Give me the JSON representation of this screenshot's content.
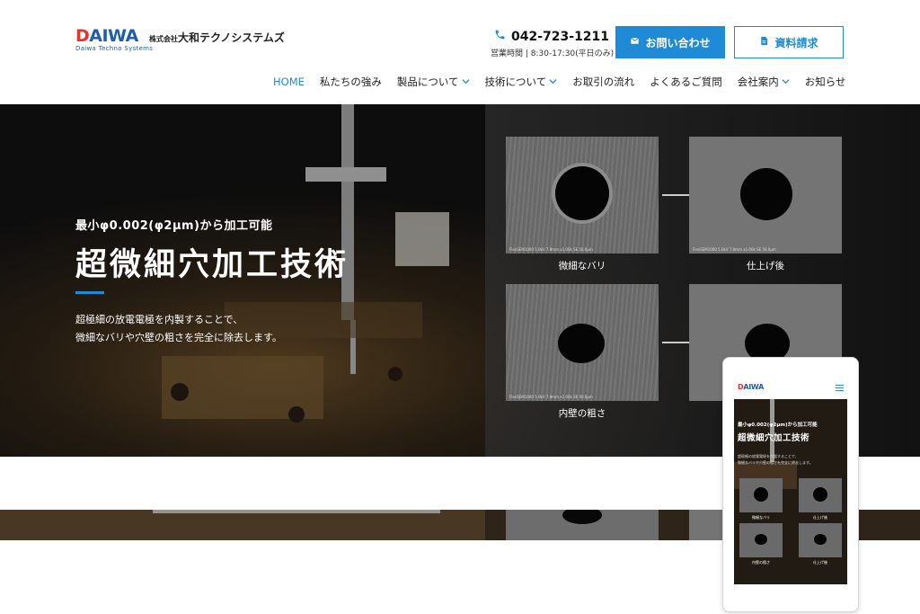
{
  "header": {
    "logo_mark_d": "D",
    "logo_mark_rest": "AIWA",
    "logo_sub": "Daiwa Techno Systems",
    "company_prefix": "株式会社",
    "company_name": "大和テクノシステムズ",
    "phone": "042-723-1211",
    "hours": "営業時間 | 8:30-17:30(平日のみ)",
    "contact_label": "お問い合わせ",
    "doc_label": "資料請求",
    "accent": "#1f8bd6",
    "icons": {
      "phone": "phone-icon",
      "contact": "mail-icon",
      "doc": "document-icon"
    }
  },
  "nav": {
    "items": [
      {
        "label": "HOME",
        "active": true,
        "dropdown": false
      },
      {
        "label": "私たちの強み",
        "active": false,
        "dropdown": false
      },
      {
        "label": "製品について",
        "active": false,
        "dropdown": true
      },
      {
        "label": "技術について",
        "active": false,
        "dropdown": true
      },
      {
        "label": "お取引の流れ",
        "active": false,
        "dropdown": false
      },
      {
        "label": "よくあるご質問",
        "active": false,
        "dropdown": false
      },
      {
        "label": "会社案内",
        "active": false,
        "dropdown": true
      },
      {
        "label": "お知らせ",
        "active": false,
        "dropdown": false
      }
    ]
  },
  "hero": {
    "subtitle": "最小φ0.002(φ2μm)から加工可能",
    "title": "超微細穴加工技術",
    "desc_line1": "超極細の放電電極を内製することで、",
    "desc_line2": "微細なバリや穴壁の粗さを完全に除去します。",
    "sem_captions": [
      "微細なバリ",
      "仕上げ後",
      "内壁の粗さ",
      "仕上げ後"
    ],
    "sem_meta": "FlexSEM1000 5.0kV 7.9mm x1.00k SE   50.0μm"
  },
  "mobile": {
    "logo_mark_d": "D",
    "logo_mark_rest": "AIWA",
    "subtitle": "最小φ0.002(φ2μm)から加工可能",
    "title": "超微細穴加工技術",
    "desc_line1": "超極細の放電電極を内製することで、",
    "desc_line2": "微細なバリや穴壁の粗さを完全に除去します。",
    "captions": [
      "微細なバリ",
      "仕上げ後",
      "内壁の粗さ",
      "仕上げ後"
    ]
  }
}
